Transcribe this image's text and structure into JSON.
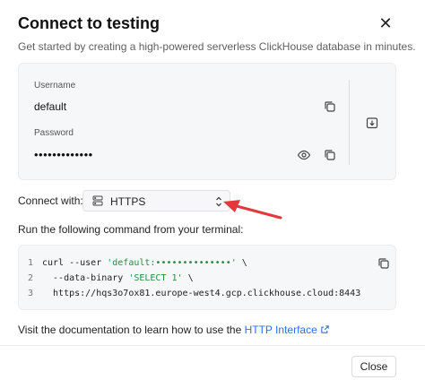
{
  "dialog": {
    "title": "Connect to testing",
    "close_icon": "close-icon",
    "subtitle": "Get started by creating a high-powered serverless ClickHouse database in minutes."
  },
  "credentials": {
    "username_label": "Username",
    "username_value": "default",
    "password_label": "Password",
    "password_value": "•••••••••••••",
    "icons": [
      "copy-icon",
      "eye-icon",
      "download-icon"
    ]
  },
  "connect": {
    "label": "Connect with:",
    "selected": "HTTPS"
  },
  "command": {
    "label": "Run the following command from your terminal:",
    "lines": [
      {
        "num": "1",
        "pre": "curl --user ",
        "str": "'default:••••••••••••••'",
        "post": " \\"
      },
      {
        "num": "2",
        "pre": "  --data-binary ",
        "str": "'SELECT 1'",
        "post": " \\"
      },
      {
        "num": "3",
        "pre": "  https://hqs3o7ox81.europe-west4.gcp.clickhouse.cloud:8443",
        "str": "",
        "post": ""
      }
    ]
  },
  "docs": {
    "prefix": "Visit the documentation to learn how to use the ",
    "link": "HTTP Interface"
  },
  "footer": {
    "close_label": "Close"
  },
  "colors": {
    "link": "#2f6fe4",
    "arrow": "#e5383b",
    "string": "#2b8a3e"
  }
}
